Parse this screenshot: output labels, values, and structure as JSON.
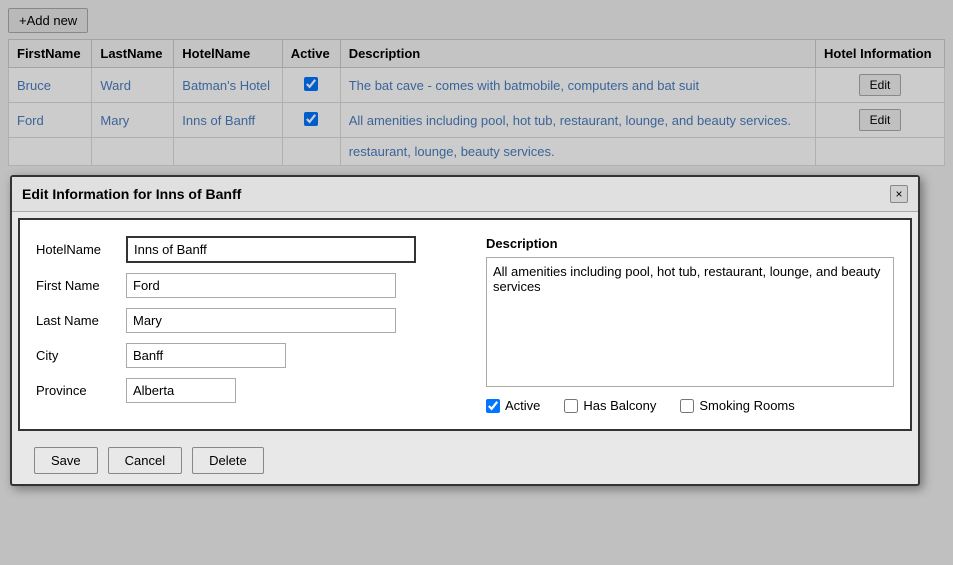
{
  "toolbar": {
    "add_new_label": "+Add new"
  },
  "table": {
    "headers": [
      "FirstName",
      "LastName",
      "HotelName",
      "Active",
      "Description",
      "Hotel Information"
    ],
    "rows": [
      {
        "first_name": "Bruce",
        "last_name": "Ward",
        "hotel_name": "Batman's Hotel",
        "active": true,
        "description": "The bat cave - comes with batmobile, computers and bat suit",
        "action": "Edit"
      },
      {
        "first_name": "Ford",
        "last_name": "Mary",
        "hotel_name": "Inns of Banff",
        "active": true,
        "description": "All amenities including pool, hot tub, restaurant, lounge, and beauty services.",
        "action": "Edit"
      }
    ],
    "bottom_row_desc": "restaurant, lounge, beauty services."
  },
  "modal": {
    "title": "Edit Information for Inns of Banff",
    "close_label": "×",
    "fields": {
      "hotel_name_label": "HotelName",
      "hotel_name_value": "Inns of Banff",
      "first_name_label": "First Name",
      "first_name_value": "Ford",
      "last_name_label": "Last Name",
      "last_name_value": "Mary",
      "city_label": "City",
      "city_value": "Banff",
      "province_label": "Province",
      "province_value": "Alberta"
    },
    "description": {
      "label": "Description",
      "value": "All amenities including pool, hot tub, restaurant, lounge, and beauty services"
    },
    "checkboxes": {
      "active_label": "Active",
      "active_checked": true,
      "has_balcony_label": "Has Balcony",
      "has_balcony_checked": false,
      "smoking_rooms_label": "Smoking Rooms",
      "smoking_rooms_checked": false
    },
    "buttons": {
      "save_label": "Save",
      "cancel_label": "Cancel",
      "delete_label": "Delete"
    }
  }
}
